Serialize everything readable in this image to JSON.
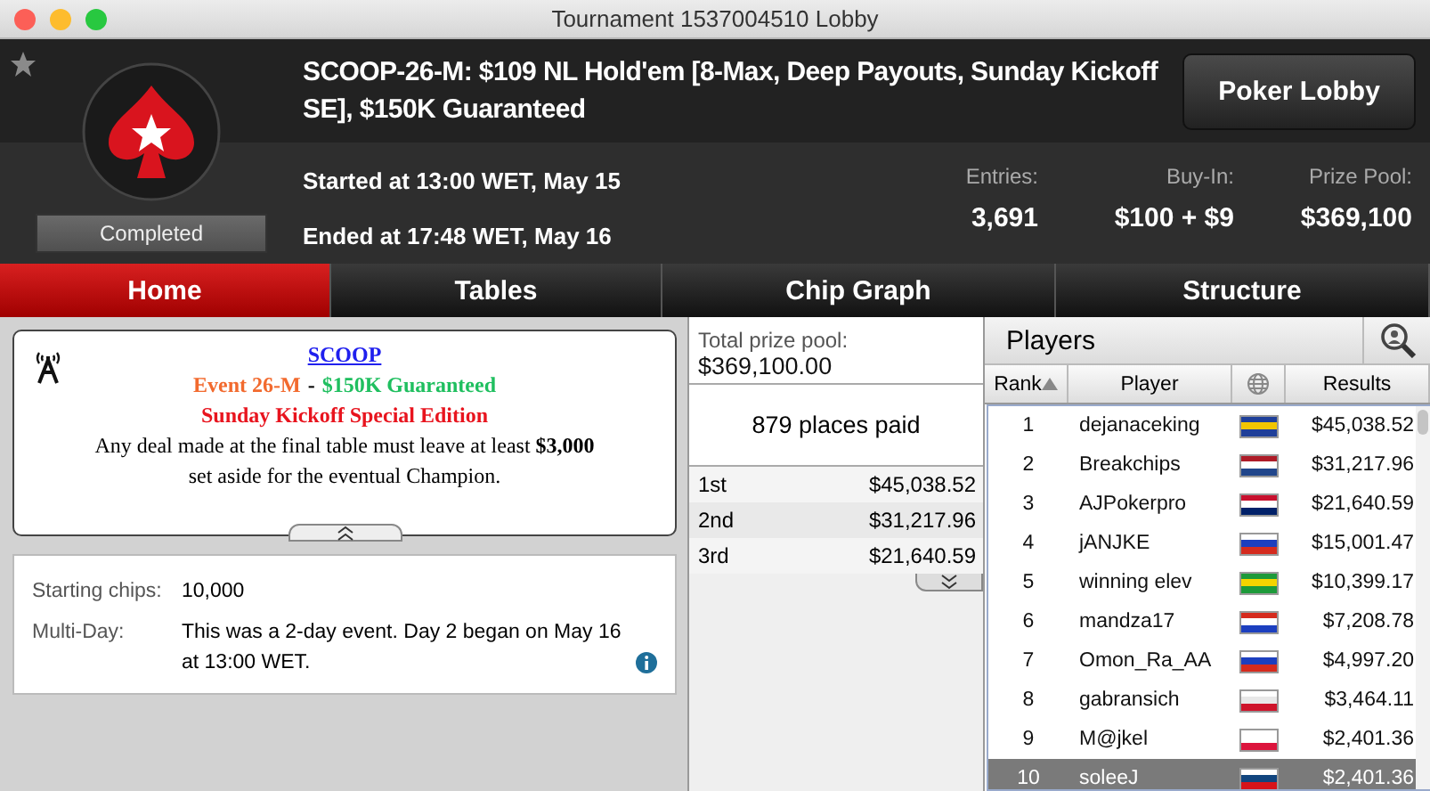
{
  "window": {
    "title": "Tournament 1537004510 Lobby"
  },
  "header": {
    "title": "SCOOP-26-M: $109 NL Hold'em [8-Max, Deep Payouts, Sunday Kickoff SE], $150K Guaranteed",
    "status": "Completed",
    "favorite": false,
    "started": "Started at 13:00 WET, May 15",
    "ended": "Ended at 17:48 WET, May 16",
    "button": "Poker Lobby",
    "stats": [
      {
        "label": "Entries:",
        "value": "3,691"
      },
      {
        "label": "Buy-In:",
        "value": "$100 + $9"
      },
      {
        "label": "Prize Pool:",
        "value": "$369,100"
      }
    ]
  },
  "tabs": [
    {
      "label": "Home",
      "selected": true
    },
    {
      "label": "Tables",
      "selected": false
    },
    {
      "label": "Chip Graph",
      "selected": false
    },
    {
      "label": "Structure",
      "selected": false
    }
  ],
  "notice": {
    "link": "SCOOP",
    "event_parts": [
      {
        "text": "Event 26-M",
        "color": "#f26a2e"
      },
      {
        "text": "-",
        "color": "#000000"
      },
      {
        "text": "$150K Guaranteed",
        "color": "#1fbf5f"
      }
    ],
    "subtitle": "Sunday Kickoff Special Edition",
    "body": "Any deal made at the final table must leave at least **$3,000** set aside for the eventual Champion."
  },
  "details": [
    {
      "label": "Starting chips:",
      "value": "10,000",
      "info": false
    },
    {
      "label": "Multi-Day:",
      "value": "This was a 2-day event. Day 2 began on May 16 at 13:00 WET.",
      "info": true
    }
  ],
  "prizes": {
    "total_label": "Total prize pool:",
    "total": "$369,100.00",
    "places": "879 places paid",
    "rows": [
      {
        "place": "1st",
        "amount": "$45,038.52"
      },
      {
        "place": "2nd",
        "amount": "$31,217.96"
      },
      {
        "place": "3rd",
        "amount": "$21,640.59"
      }
    ]
  },
  "players": {
    "title": "Players",
    "columns": [
      "Rank",
      "Player",
      "Results"
    ],
    "rows": [
      {
        "rank": "1",
        "name": "dejanaceking",
        "flag": [
          {
            "color": "#1f3f99"
          },
          {
            "color": "#f2c500"
          },
          {
            "color": "#1f3f99"
          }
        ],
        "result": "$45,038.52",
        "selected": false
      },
      {
        "rank": "2",
        "name": "Breakchips",
        "flag": [
          {
            "color": "#ae1c28"
          },
          {
            "color": "#ffffff"
          },
          {
            "color": "#21468b"
          }
        ],
        "result": "$31,217.96",
        "selected": false
      },
      {
        "rank": "3",
        "name": "AJPokerpro",
        "flag": [
          {
            "color": "#c8102e"
          },
          {
            "color": "#ffffff"
          },
          {
            "color": "#012169"
          }
        ],
        "result": "$21,640.59",
        "selected": false
      },
      {
        "rank": "4",
        "name": "jANJKE",
        "flag": [
          {
            "color": "#ffffff"
          },
          {
            "color": "#1c3fbf"
          },
          {
            "color": "#d52b1e"
          }
        ],
        "result": "$15,001.47",
        "selected": false
      },
      {
        "rank": "5",
        "name": "winning elev",
        "flag": [
          {
            "color": "#1d9a3a"
          },
          {
            "color": "#f5d400"
          },
          {
            "color": "#1d9a3a"
          }
        ],
        "result": "$10,399.17",
        "selected": false
      },
      {
        "rank": "6",
        "name": "mandza17",
        "flag": [
          {
            "color": "#d52b1e"
          },
          {
            "color": "#ffffff"
          },
          {
            "color": "#1c3fbf"
          }
        ],
        "result": "$7,208.78",
        "selected": false
      },
      {
        "rank": "7",
        "name": "Omon_Ra_AA",
        "flag": [
          {
            "color": "#ffffff"
          },
          {
            "color": "#1c3fbf"
          },
          {
            "color": "#d52b1e"
          }
        ],
        "result": "$4,997.20",
        "selected": false
      },
      {
        "rank": "8",
        "name": "gabransich",
        "flag": [
          {
            "color": "#ffffff"
          },
          {
            "color": "#e8e8e8"
          },
          {
            "color": "#cf142b"
          }
        ],
        "result": "$3,464.11",
        "selected": false
      },
      {
        "rank": "9",
        "name": "M@jkel",
        "flag": [
          {
            "color": "#ffffff"
          },
          {
            "color": "#ffffff"
          },
          {
            "color": "#dc143c"
          }
        ],
        "result": "$2,401.36",
        "selected": false
      },
      {
        "rank": "10",
        "name": "soleeJ",
        "flag": [
          {
            "color": "#ffffff"
          },
          {
            "color": "#11457e"
          },
          {
            "color": "#d7141a"
          }
        ],
        "result": "$2,401.36",
        "selected": true
      }
    ]
  }
}
